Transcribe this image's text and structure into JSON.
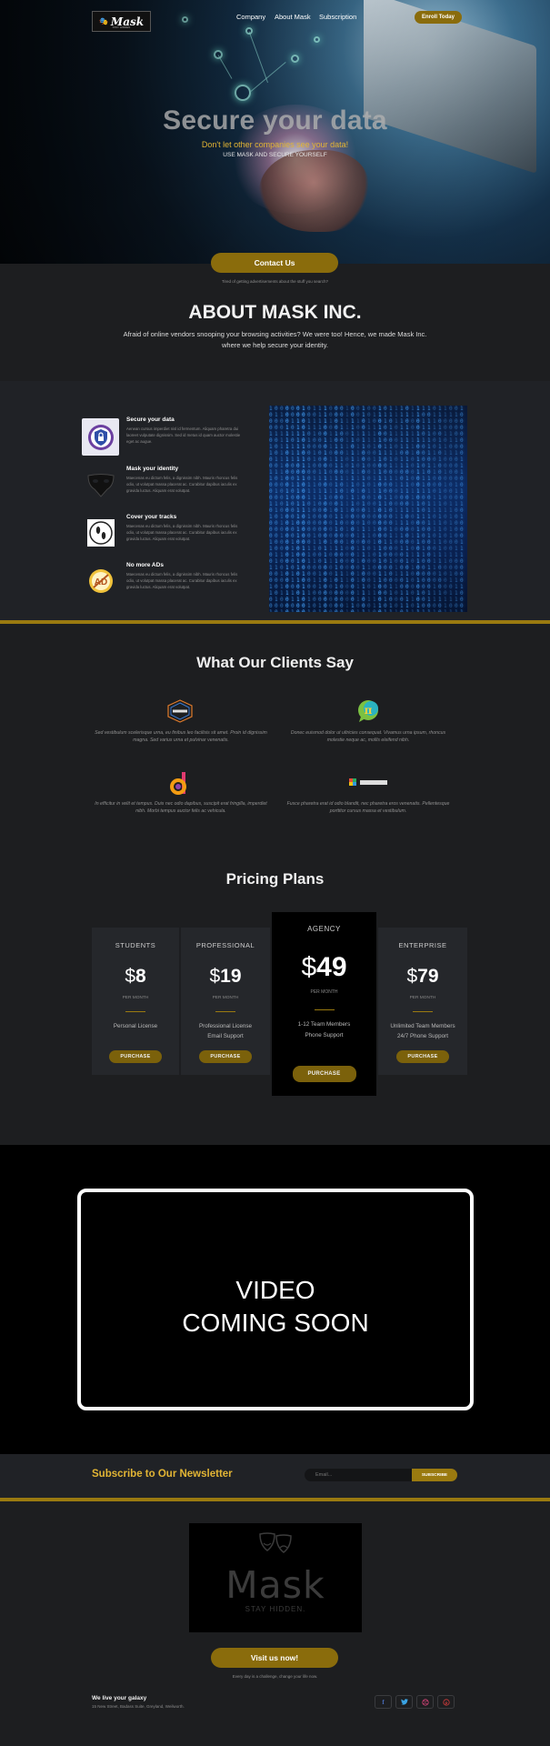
{
  "header": {
    "logo_text": "Mask",
    "logo_tagline": "STAY HIDDEN",
    "nav": [
      "Company",
      "About Mask",
      "Subscription"
    ],
    "cta": "Enroll Today"
  },
  "hero": {
    "title": "Secure your data",
    "subtitle": "Don't let other companies see your data!",
    "tagline": "USE MASK AND SECURE YOURSELF"
  },
  "contact": {
    "button": "Contact Us",
    "note": "Tired of getting advertisements about the stuff you search?"
  },
  "about": {
    "title": "ABOUT MASK INC.",
    "text": "Afraid of online vendors snooping your browsing activities? We were too! Hence, we made Mask Inc. where we help secure your identity."
  },
  "features": [
    {
      "title": "Secure your data",
      "body": "Aenean cursus imperdiet nisl id fermentum. Aliquam pharetra dui laoreet vulputate dignissim. Sed id metus id quam auctor molestie eget ac augue.",
      "icon": "shield-lock-icon"
    },
    {
      "title": "Mask your identity",
      "body": "Maecenas eu dictum felis, a dignissim nibh. Mauris rhoncus felis odio, ut volutpat massa placerat ac. Curabitur dapibus iaculis ex gravida luctus. Aliquam erat volutpat.",
      "icon": "theatre-mask-icon"
    },
    {
      "title": "Cover your tracks",
      "body": "Maecenas eu dictum felis, a dignissim nibh. Mauris rhoncus felis odio, ut volutpat massa placerat ac. Curabitur dapibus iaculis ex gravida luctus. Aliquam erat volutpat.",
      "icon": "footprints-icon"
    },
    {
      "title": "No more ADs",
      "body": "Maecenas eu dictum felis, a dignissim nibh. Mauris rhoncus felis odio, ut volutpat massa placerat ac. Curabitur dapibus iaculis ex gravida luctus. Aliquam erat volutpat.",
      "icon": "no-ads-icon"
    }
  ],
  "testimonials": {
    "title": "What Our Clients Say",
    "items": [
      {
        "quote": "Sed vestibulum scelerisque urna, eu finibus leo facilisis sit amet. Proin id dignissim magna. Sed varius urna et pulvinar venenatis.",
        "logo": "hexagon-brand-logo"
      },
      {
        "quote": "Donec euismod dolor ut ultricies consequat. Vivamus urna ipsum, rhoncus molestie neque ac, mollis eleifend nibh.",
        "logo": "pi-bubble-logo"
      },
      {
        "quote": "In efficitur in velit et tempus. Duis nec odio dapibus, suscipit erat fringilla, imperdiet nibh. Morbi tempus auctor felis ac vehicula.",
        "logo": "colorful-d-logo"
      },
      {
        "quote": "Fusce pharetra erat id odio blandit, nec pharetra eros venenatis. Pellentesque porttitor cursus massa et vestibulum.",
        "logo": "pixel-brand-logo"
      }
    ]
  },
  "pricing": {
    "title": "Pricing Plans",
    "currency": "$",
    "per": "PER MONTH",
    "purchase": "PURCHASE",
    "plans": [
      {
        "name": "STUDENTS",
        "price": "8",
        "features": [
          "Personal License"
        ]
      },
      {
        "name": "PROFESSIONAL",
        "price": "19",
        "features": [
          "Professional License",
          "Email Support"
        ]
      },
      {
        "name": "AGENCY",
        "price": "49",
        "features": [
          "1-12 Team Members",
          "Phone Support"
        ]
      },
      {
        "name": "ENTERPRISE",
        "price": "79",
        "features": [
          "Unlimited Team Members",
          "24/7 Phone Support"
        ]
      }
    ]
  },
  "video": {
    "line1": "VIDEO",
    "line2": "COMING SOON"
  },
  "newsletter": {
    "title": "Subscribe to Our Newsletter",
    "placeholder": "Email...",
    "button": "SUBSCRIBE"
  },
  "brand_box": {
    "name": "Mask",
    "tagline": "STAY HIDDEN."
  },
  "visit": {
    "button": "Visit us now!",
    "note": "Every day is a challenge, change your life now."
  },
  "footer": {
    "title": "We live your galaxy",
    "address": "15 New Street, Badass Suite, Greyland, Weilworth.",
    "social": [
      "facebook-icon",
      "twitter-icon",
      "dribbble-icon",
      "pinterest-icon"
    ]
  },
  "colors": {
    "accent_gold": "#8a6c0c",
    "highlight_yellow": "#e2b534",
    "background": "#1d1e20",
    "panel": "#202226"
  }
}
